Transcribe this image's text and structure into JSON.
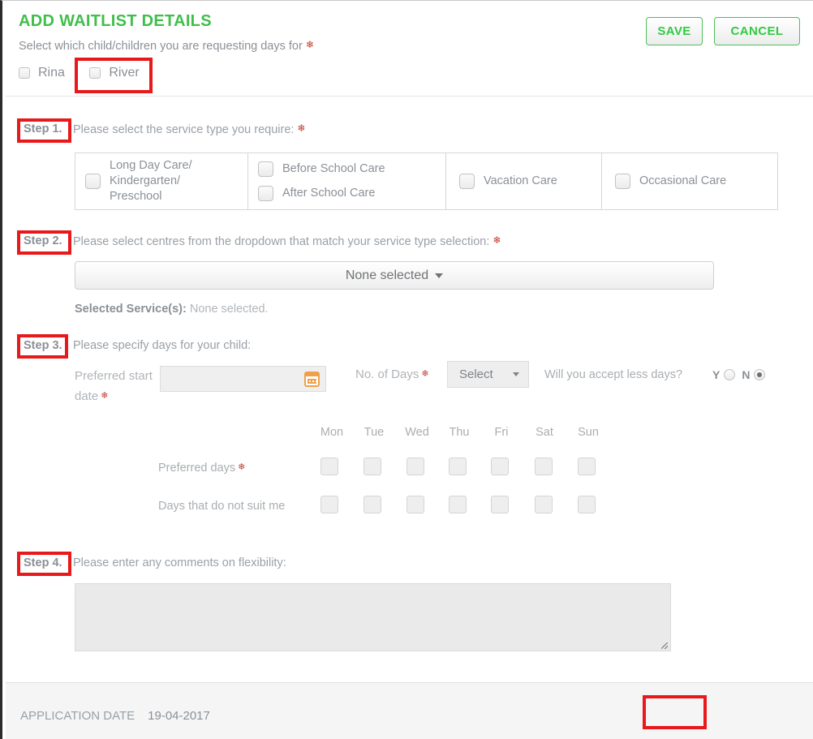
{
  "header": {
    "title": "ADD WAITLIST DETAILS",
    "subtitle": "Select which child/children you are requesting days for",
    "children": [
      {
        "label": "Rina",
        "checked": false
      },
      {
        "label": "River",
        "checked": false
      }
    ]
  },
  "steps": {
    "step1": {
      "label": "Step 1.",
      "text": "Please select the service type you require:",
      "options": [
        {
          "label": "Long Day Care/ Kindergarten/ Preschool",
          "checked": false
        },
        {
          "label": "Before School Care",
          "checked": false
        },
        {
          "label": "After School Care",
          "checked": false
        },
        {
          "label": "Vacation Care",
          "checked": false
        },
        {
          "label": "Occasional Care",
          "checked": false
        }
      ]
    },
    "step2": {
      "label": "Step 2.",
      "text": "Please select centres from the dropdown that match your service type selection:",
      "dropdown_value": "None selected",
      "selected_services_label": "Selected Service(s):",
      "selected_services_value": "None selected."
    },
    "step3": {
      "label": "Step 3.",
      "text": "Please specify days for your child:",
      "preferred_start_date_label": "Preferred start date",
      "preferred_start_date_value": "",
      "no_of_days_label": "No. of Days",
      "no_of_days_value": "Select",
      "accept_less_days_label": "Will you accept less days?",
      "yes_label": "Y",
      "no_label": "N",
      "accept_less_days_selected": "N",
      "day_headers": [
        "Mon",
        "Tue",
        "Wed",
        "Thu",
        "Fri",
        "Sat",
        "Sun"
      ],
      "preferred_days_label": "Preferred days",
      "not_suit_days_label": "Days that do not suit me"
    },
    "step4": {
      "label": "Step 4.",
      "text": "Please enter any comments on flexibility:",
      "comments_value": ""
    }
  },
  "footer": {
    "application_date_label": "APPLICATION DATE",
    "application_date_value": "19-04-2017",
    "save_label": "SAVE",
    "cancel_label": "CANCEL"
  },
  "colors": {
    "title_green": "#3fbf4a",
    "button_green": "#2ecc40",
    "required_red": "#c0392b",
    "annotation_red": "#e8191b"
  }
}
